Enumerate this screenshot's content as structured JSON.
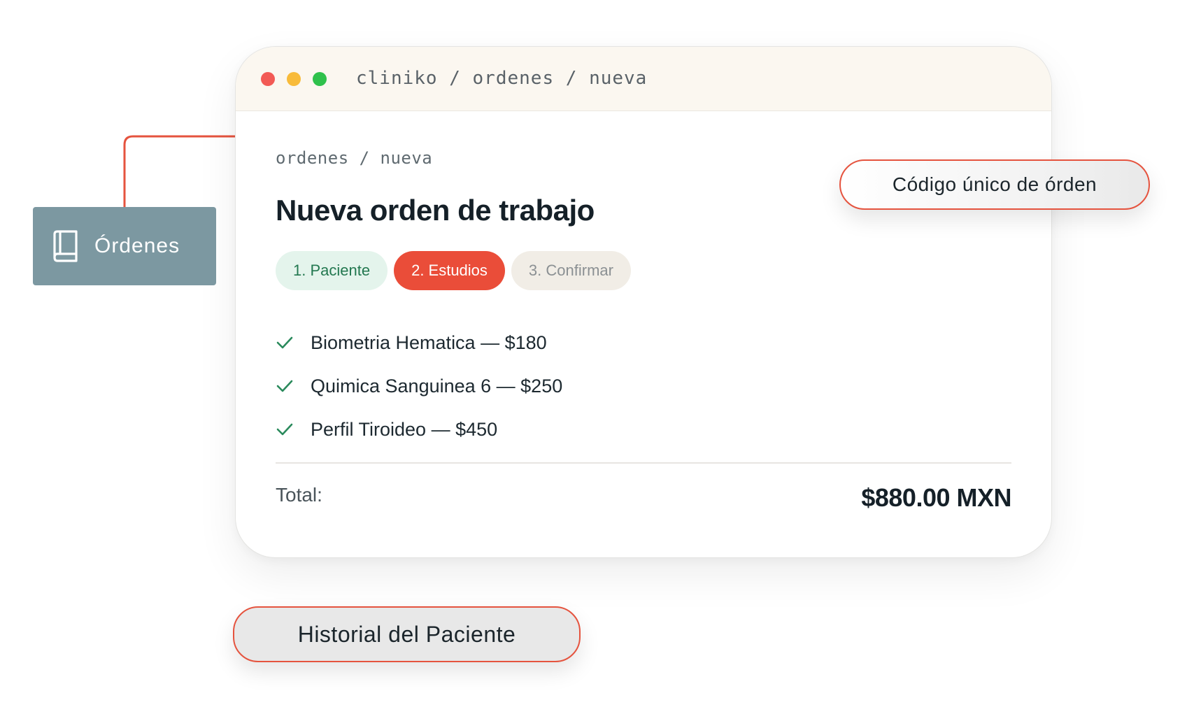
{
  "window": {
    "url_path": "cliniko / ordenes / nueva",
    "traffic_lights": [
      "close",
      "minimize",
      "maximize"
    ]
  },
  "page": {
    "breadcrumb": "ordenes / nueva",
    "title": "Nueva orden de trabajo",
    "steps": [
      {
        "label": "1. Paciente",
        "state": "done"
      },
      {
        "label": "2. Estudios",
        "state": "active"
      },
      {
        "label": "3. Confirmar",
        "state": "pending"
      }
    ],
    "studies": [
      {
        "label": "Biometria Hematica — $180",
        "icon": "check-icon"
      },
      {
        "label": "Quimica Sanguinea 6 — $250",
        "icon": "check-icon"
      },
      {
        "label": "Perfil Tiroideo — $450",
        "icon": "check-icon"
      }
    ],
    "total_label": "Total:",
    "total_value": "$880.00 MXN"
  },
  "callouts": {
    "ordenes": {
      "label": "Órdenes",
      "icon": "book-icon"
    },
    "codigo": "Código único de órden",
    "historial": "Historial del Paciente"
  },
  "colors": {
    "accent": "#ea4d39",
    "success": "#237850",
    "sidebar_card": "#7c98a1",
    "titlebar": "#fbf7f0"
  }
}
